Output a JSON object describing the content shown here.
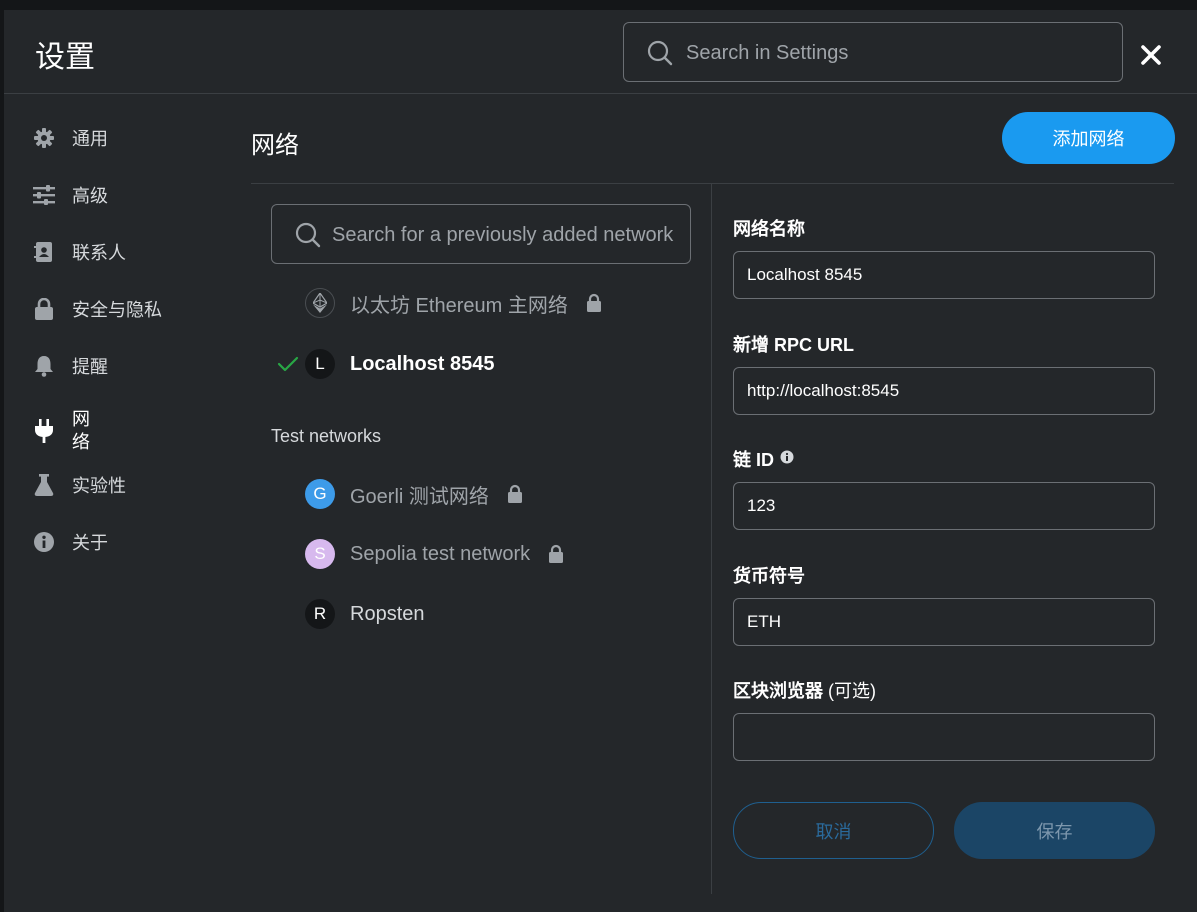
{
  "header": {
    "title": "设置",
    "search_placeholder": "Search in Settings"
  },
  "sidebar": {
    "items": [
      {
        "label": "通用",
        "icon": "gear-icon"
      },
      {
        "label": "高级",
        "icon": "sliders-icon"
      },
      {
        "label": "联系人",
        "icon": "contact-book-icon"
      },
      {
        "label": "安全与隐私",
        "icon": "lock-icon"
      },
      {
        "label": "提醒",
        "icon": "bell-icon"
      },
      {
        "label": "网络",
        "icon": "plug-icon",
        "active": true
      },
      {
        "label": "实验性",
        "icon": "flask-icon"
      },
      {
        "label": "关于",
        "icon": "info-icon"
      }
    ]
  },
  "networks": {
    "title": "网络",
    "add_button": "添加网络",
    "search_placeholder": "Search for a previously added network",
    "main": [
      {
        "avatar": "ethereum-icon",
        "name": "以太坊 Ethereum 主网络",
        "locked": true
      },
      {
        "avatar": "L",
        "name": "Localhost 8545",
        "selected": true
      }
    ],
    "test_header": "Test networks",
    "test": [
      {
        "avatar": "G",
        "color": "#3d9be9",
        "name": "Goerli 测试网络",
        "locked": true
      },
      {
        "avatar": "S",
        "color": "#d7b9ee",
        "name": "Sepolia test network",
        "locked": true
      },
      {
        "avatar": "R",
        "color": "#141618",
        "name": "Ropsten",
        "locked": false
      }
    ]
  },
  "form": {
    "network_name_label": "网络名称",
    "network_name_value": "Localhost 8545",
    "rpc_label": "新增 RPC URL",
    "rpc_value": "http://localhost:8545",
    "chain_id_label": "链 ID",
    "chain_id_value": "123",
    "symbol_label": "货币符号",
    "symbol_value": "ETH",
    "explorer_label": "区块浏览器",
    "explorer_optional": "(可选)",
    "explorer_value": "",
    "cancel_label": "取消",
    "save_label": "保存"
  },
  "colors": {
    "accent": "#1a9af0",
    "background": "#24272a",
    "check": "#28a745"
  }
}
